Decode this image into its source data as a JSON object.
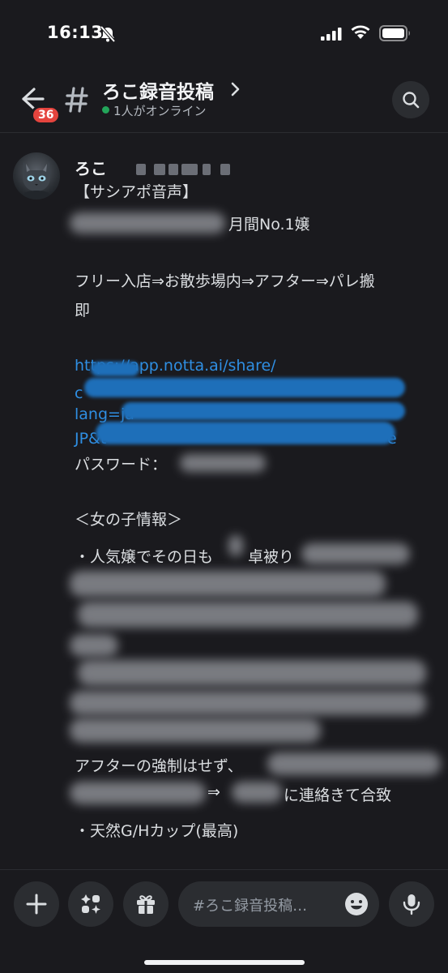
{
  "status_bar": {
    "time": "16:13"
  },
  "header": {
    "back_badge": "36",
    "channel_name": "ろこ録音投稿",
    "online_status": "1人がオンライン"
  },
  "message": {
    "author": "ろこ",
    "lines": {
      "title": "【サシアポ音声】",
      "rank_suffix": "月間No.1嬢",
      "flow_1": "フリー入店⇒お散歩場内⇒アフター⇒パレ搬",
      "flow_2": "即",
      "link_1": "https://app.notta.ai/share/",
      "link_2": "c",
      "link_3": "lang=ja-",
      "link_4": "JP&t=",
      "link_4_end": "e",
      "password_label": "パスワード：",
      "girl_info_heading": "＜女の子情報＞",
      "info_1": "・人気嬢でその日も",
      "info_1b": "卓被り",
      "after_1": "アフターの強制はせず、",
      "after_2_mid": "⇒",
      "after_2_end": "に連絡きて合致",
      "cup": "・天然G/Hカップ(最高)"
    }
  },
  "composer": {
    "placeholder": "#ろこ録音投稿…"
  },
  "icons": {
    "back": "arrow-left-icon",
    "hash": "hash-icon",
    "search": "search-icon",
    "add": "plus-icon",
    "apps": "sparkle-apps-icon",
    "gift": "gift-icon",
    "emoji": "emoji-icon",
    "mic": "microphone-icon",
    "bell_off": "bell-slash-icon"
  },
  "colors": {
    "background": "#1a1a1e",
    "link": "#2f8fe3",
    "badge": "#e5443e",
    "online": "#23a55a"
  }
}
